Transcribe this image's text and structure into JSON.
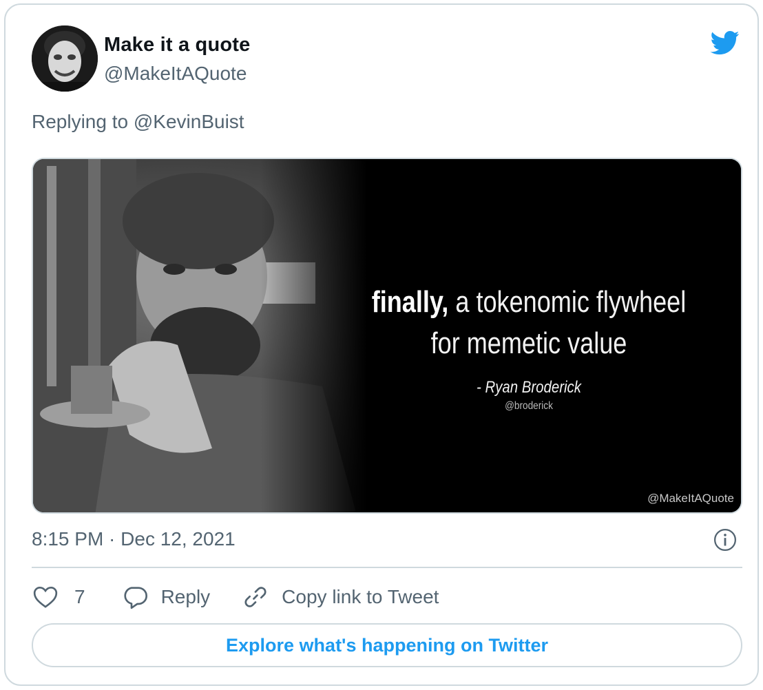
{
  "author": {
    "display_name": "Make it a quote",
    "handle": "@MakeItAQuote"
  },
  "replying_to": "Replying to @KevinBuist",
  "media": {
    "quote_bold": "finally,",
    "quote_rest_line1": " a tokenomic flywheel",
    "quote_line2": "for memetic value",
    "attribution": "- Ryan Broderick",
    "attribution_handle": "@broderick",
    "watermark": "@MakeItAQuote"
  },
  "timestamp": "8:15 PM · Dec 12, 2021",
  "actions": {
    "like_count": "7",
    "reply_label": "Reply",
    "copy_link_label": "Copy link to Tweet"
  },
  "cta": {
    "label": "Explore what's happening on Twitter"
  },
  "icons": {
    "twitter": "twitter-bird-icon",
    "info": "info-icon",
    "like": "heart-icon",
    "reply": "speech-bubble-icon",
    "copy_link": "link-icon"
  },
  "colors": {
    "brand_blue": "#1d9bf0",
    "text_primary": "#0f1419",
    "text_secondary": "#536471",
    "border": "#cfd9de"
  }
}
